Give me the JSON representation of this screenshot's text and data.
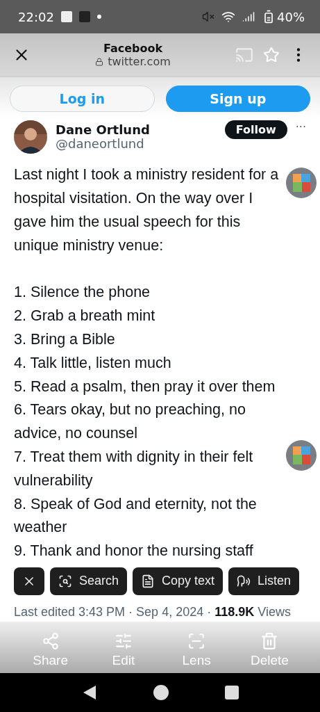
{
  "status_bar": {
    "time": "22:02",
    "battery": "40%"
  },
  "browser": {
    "title": "Facebook",
    "url": "twitter.com"
  },
  "auth_buttons": [
    {
      "label": "Log in",
      "kind": "outline"
    },
    {
      "label": "Sign up",
      "kind": "filled"
    }
  ],
  "tweet": {
    "author": "Dane Ortlund",
    "handle": "@daneortlund",
    "follow": "Follow",
    "more": "···",
    "intro": "Last night I took a ministry resident for a hospital visitation. On the way over I gave him the usual speech for this unique ministry venue:",
    "items": [
      "1. Silence the phone",
      "2. Grab a breath mint",
      "3. Bring a Bible",
      "4. Talk little, listen much",
      "5. Read a psalm, then pray it over them",
      "6. Tears okay, but no preaching, no advice, no counsel",
      "7. Treat them with dignity in their felt vulnerability",
      "8. Speak of God and eternity, not the weather",
      "9. Thank and honor the nursing staff"
    ],
    "meta": "Last edited 3:43 PM · Sep 4, 2024 · **118.9K** Views"
  },
  "lens_chips": [
    {
      "kind": "close"
    },
    {
      "kind": "search",
      "label": "Search"
    },
    {
      "kind": "copy",
      "label": "Copy text"
    },
    {
      "kind": "listen",
      "label": "Listen"
    }
  ],
  "actions": [
    {
      "kind": "share",
      "label": "Share"
    },
    {
      "kind": "edit",
      "label": "Edit"
    },
    {
      "kind": "lens",
      "label": "Lens"
    },
    {
      "kind": "delete",
      "label": "Delete"
    }
  ]
}
